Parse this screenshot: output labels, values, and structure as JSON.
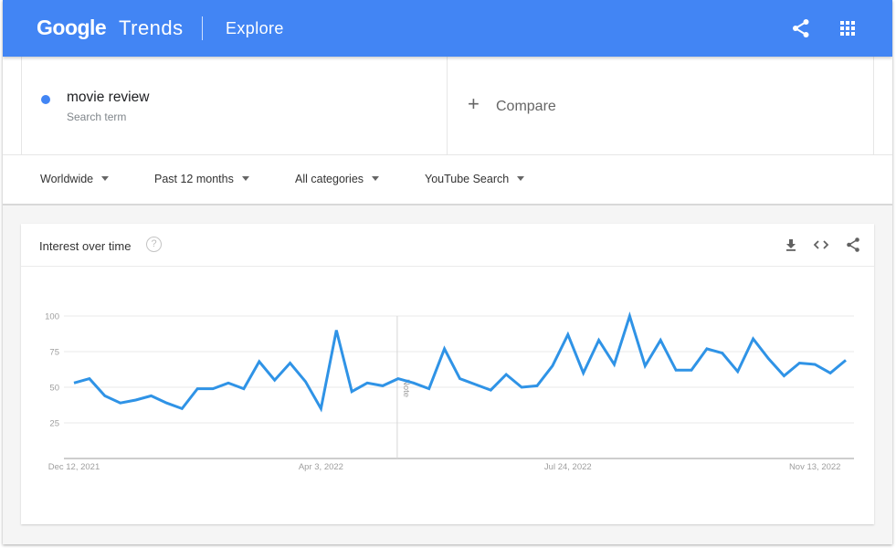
{
  "header": {
    "brand_google": "Google",
    "brand_product": "Trends",
    "page_name": "Explore",
    "bar_color": "#4285f4",
    "icons": [
      "share-icon",
      "apps-grid-icon"
    ]
  },
  "search_terms": [
    {
      "name": "movie review",
      "type": "Search term",
      "color": "#4285f4"
    }
  ],
  "compare": {
    "icon": "plus-icon",
    "label": "Compare"
  },
  "filters": {
    "location": "Worldwide",
    "time_range": "Past 12 months",
    "category": "All categories",
    "search_type": "YouTube Search"
  },
  "card": {
    "title": "Interest over time",
    "help_symbol": "?",
    "actions": [
      "download-icon",
      "embed-code-icon",
      "share-icon"
    ]
  },
  "chart_data": {
    "type": "line",
    "title": "Interest over time",
    "xlabel": "",
    "ylabel": "",
    "ylim": [
      0,
      100
    ],
    "yticks": [
      25,
      50,
      75,
      100
    ],
    "grid": true,
    "legend": "none",
    "x_tick_labels": [
      {
        "index": 0,
        "label": "Dec 12, 2021"
      },
      {
        "index": 16,
        "label": "Apr 3, 2022"
      },
      {
        "index": 32,
        "label": "Jul 24, 2022"
      },
      {
        "index": 48,
        "label": "Nov 13, 2022"
      }
    ],
    "annotation": {
      "index": 21,
      "label": "Note"
    },
    "series": [
      {
        "name": "movie review",
        "color": "#2f93e6",
        "x_start": "Dec 12, 2021",
        "x_step": "1 week",
        "values": [
          53,
          56,
          44,
          39,
          41,
          44,
          39,
          35,
          49,
          49,
          53,
          49,
          68,
          55,
          67,
          54,
          35,
          90,
          47,
          53,
          51,
          56,
          53,
          49,
          77,
          56,
          52,
          48,
          59,
          50,
          51,
          65,
          87,
          60,
          83,
          66,
          100,
          65,
          83,
          62,
          62,
          77,
          74,
          61,
          84,
          70,
          58,
          67,
          66,
          60,
          69
        ]
      }
    ]
  }
}
